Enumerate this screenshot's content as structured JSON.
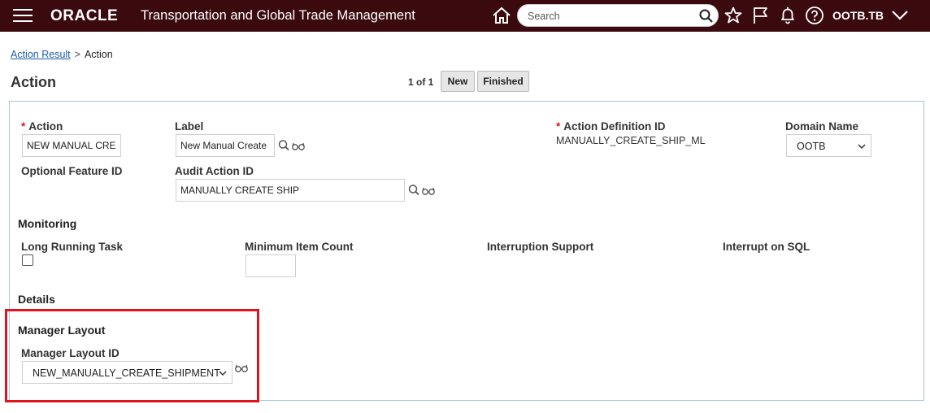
{
  "header": {
    "brand": "ORACLE",
    "app_title": "Transportation and Global Trade Management",
    "search_placeholder": "Search",
    "user": "OOTB.TB"
  },
  "breadcrumb": {
    "link": "Action Result",
    "separator": ">",
    "current": "Action"
  },
  "page": {
    "title": "Action",
    "pager": "1 of 1",
    "new_label": "New",
    "finished_label": "Finished"
  },
  "form": {
    "action": {
      "label": "Action",
      "value": "NEW MANUAL CREA"
    },
    "label_field": {
      "label": "Label",
      "value": "New Manual Create"
    },
    "action_def": {
      "label": "Action Definition ID",
      "value": "MANUALLY_CREATE_SHIP_ML"
    },
    "domain": {
      "label": "Domain Name",
      "value": "OOTB"
    },
    "optional_feature": {
      "label": "Optional Feature ID"
    },
    "audit_action": {
      "label": "Audit Action ID",
      "value": "MANUALLY CREATE SHIP"
    },
    "required_marker": "*"
  },
  "monitoring": {
    "title": "Monitoring",
    "long_running": "Long Running Task",
    "min_item_count": "Minimum Item Count",
    "interruption_support": "Interruption Support",
    "interrupt_on_sql": "Interrupt on SQL"
  },
  "details": {
    "title": "Details"
  },
  "manager_layout": {
    "title": "Manager Layout",
    "label": "Manager Layout ID",
    "value": "NEW_MANUALLY_CREATE_SHIPMENT"
  },
  "colors": {
    "header_bg": "#3a0a0f",
    "highlight": "#e0141e",
    "link": "#1b5fa8",
    "required": "#d31b1b"
  },
  "icons": [
    "hamburger-icon",
    "home-icon",
    "search-icon",
    "star-icon",
    "flag-icon",
    "bell-icon",
    "help-icon",
    "chevron-down-icon",
    "magnifier-icon",
    "glasses-icon"
  ]
}
